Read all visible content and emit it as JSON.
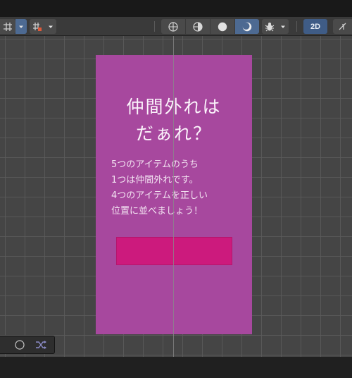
{
  "toolbar": {
    "mode_2d_label": "2D",
    "icons": [
      "globe-icon",
      "globe-shaded-icon",
      "sphere-solid-icon",
      "moon-icon",
      "bug-icon",
      "audio-off-icon",
      "grid-snap-icon",
      "increment-snap-icon"
    ]
  },
  "canvas": {
    "title": "仲間外れは\nだぁれ？",
    "body": "5つのアイテムのうち\n1つは仲間外れです。\n4つのアイテムを正しい\n位置に並べましょう！",
    "background_color": "#a7489e",
    "bar_color": "#cc1a7d"
  },
  "bottom_tools": {
    "icons": [
      "navigate-icon",
      "shuffle-icon"
    ]
  }
}
